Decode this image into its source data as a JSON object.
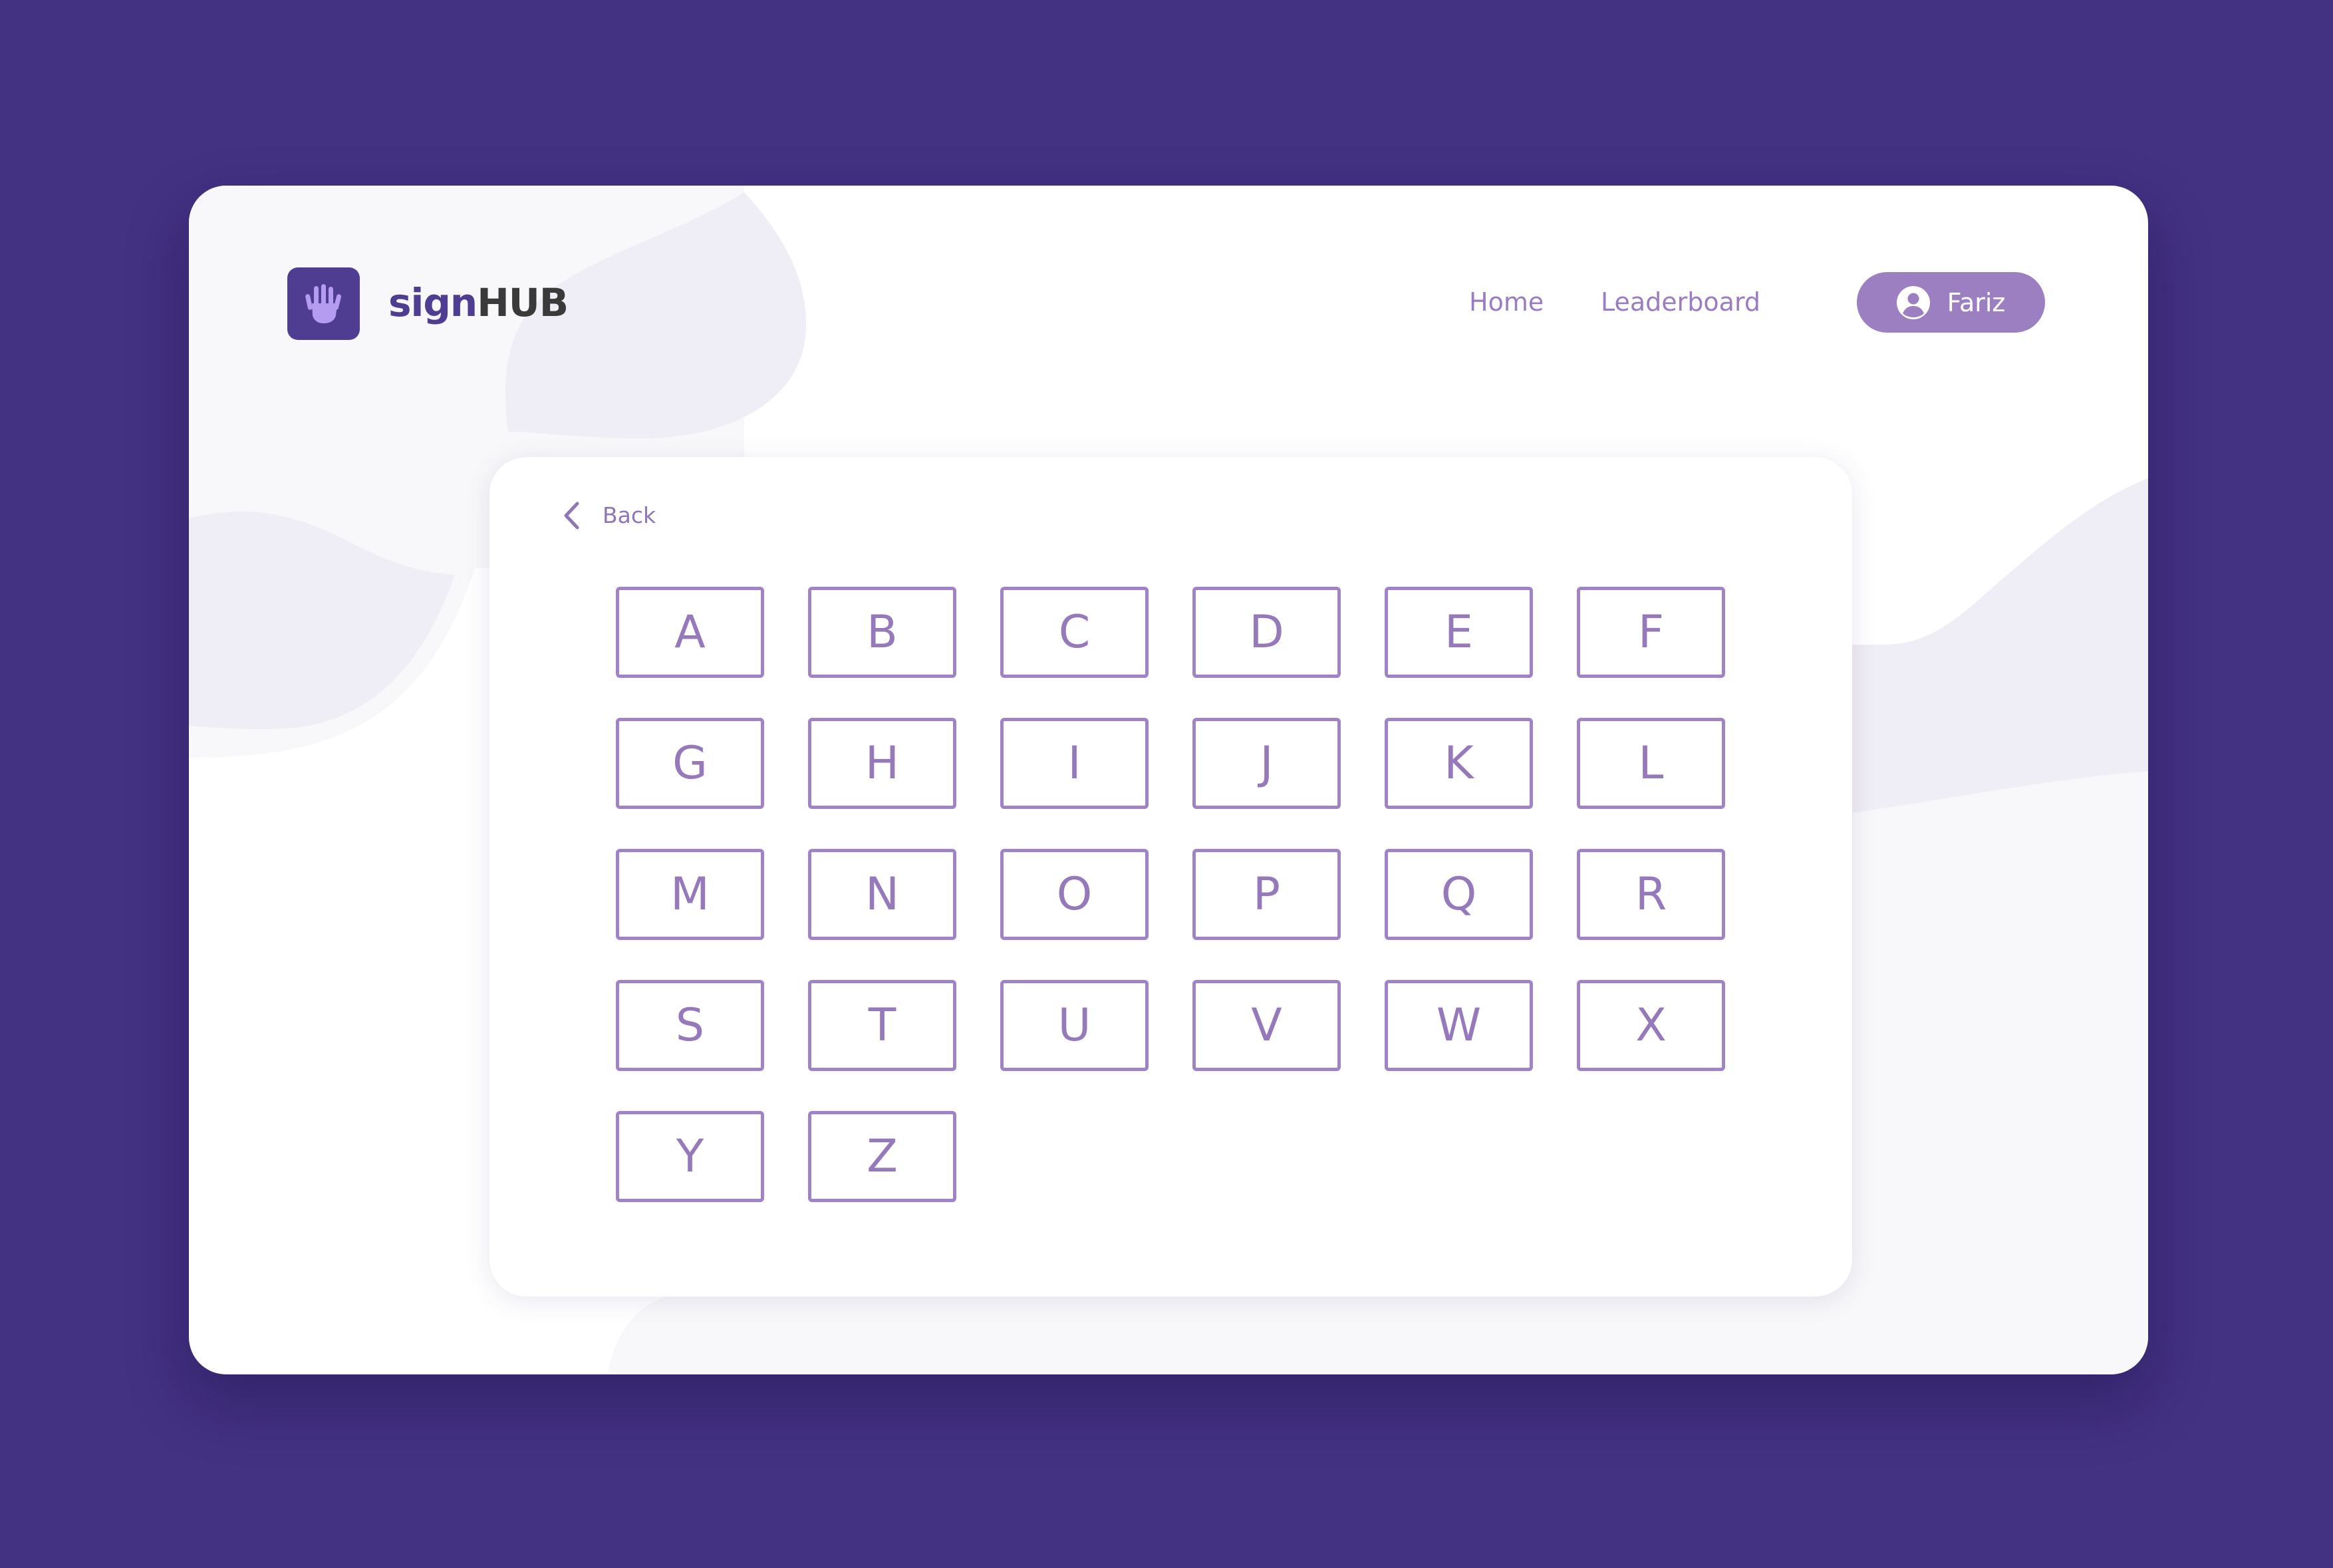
{
  "app": {
    "brand_part1": "sign",
    "brand_part2": "HUB",
    "logo_icon": "hand-icon"
  },
  "nav": {
    "home": "Home",
    "leaderboard": "Leaderboard"
  },
  "user": {
    "name": "Fariz",
    "icon": "user-circle-icon"
  },
  "card": {
    "back_label": "Back",
    "back_icon": "chevron-left-icon",
    "letters": [
      "A",
      "B",
      "C",
      "D",
      "E",
      "F",
      "G",
      "H",
      "I",
      "J",
      "K",
      "L",
      "M",
      "N",
      "O",
      "P",
      "Q",
      "R",
      "S",
      "T",
      "U",
      "V",
      "W",
      "X",
      "Y",
      "Z"
    ]
  },
  "colors": {
    "page_background": "#433182",
    "brand_purple": "#4f3d91",
    "accent_lilac": "#9b7fc0",
    "tile_border": "#a083c6",
    "blob": "#efedf5"
  }
}
